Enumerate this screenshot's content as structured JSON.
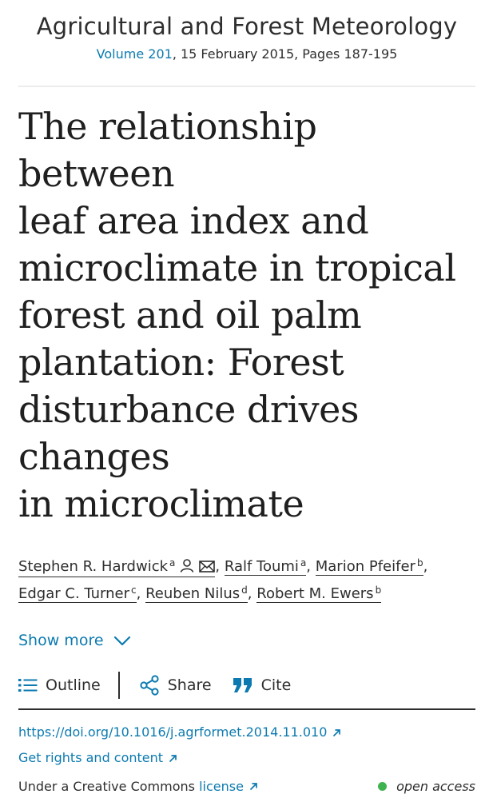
{
  "header": {
    "journal_name": "Agricultural and Forest Meteorology",
    "volume_link": "Volume 201",
    "volume_rest": ", 15 February 2015, Pages 187-195"
  },
  "article": {
    "title_lines": [
      "The relationship between",
      "leaf area index and",
      "microclimate in tropical",
      "forest and oil palm",
      "plantation: Forest",
      "disturbance drives changes",
      "in microclimate"
    ]
  },
  "authors": [
    {
      "name": "Stephen R. Hardwick",
      "sup": "a",
      "icons": [
        "person-icon",
        "mail-icon"
      ]
    },
    {
      "name": "Ralf Toumi",
      "sup": "a"
    },
    {
      "name": "Marion Pfeifer",
      "sup": "b"
    },
    {
      "name": "Edgar C. Turner",
      "sup": "c"
    },
    {
      "name": "Reuben Nilus",
      "sup": "d"
    },
    {
      "name": "Robert M. Ewers",
      "sup": "b"
    }
  ],
  "show_more": {
    "label": "Show more",
    "icon": "chevron-down-icon"
  },
  "toolbar": {
    "outline_label": "Outline",
    "share_label": "Share",
    "cite_label": "Cite"
  },
  "links": {
    "doi": "https://doi.org/10.1016/j.agrformet.2014.11.010",
    "rights": "Get rights and content"
  },
  "license": {
    "prefix": "Under a Creative Commons ",
    "link": "license",
    "access": "open access"
  },
  "colors": {
    "link": "#0c7ab0",
    "text": "#1f1f1f",
    "open_access_dot": "#3fb34f"
  }
}
